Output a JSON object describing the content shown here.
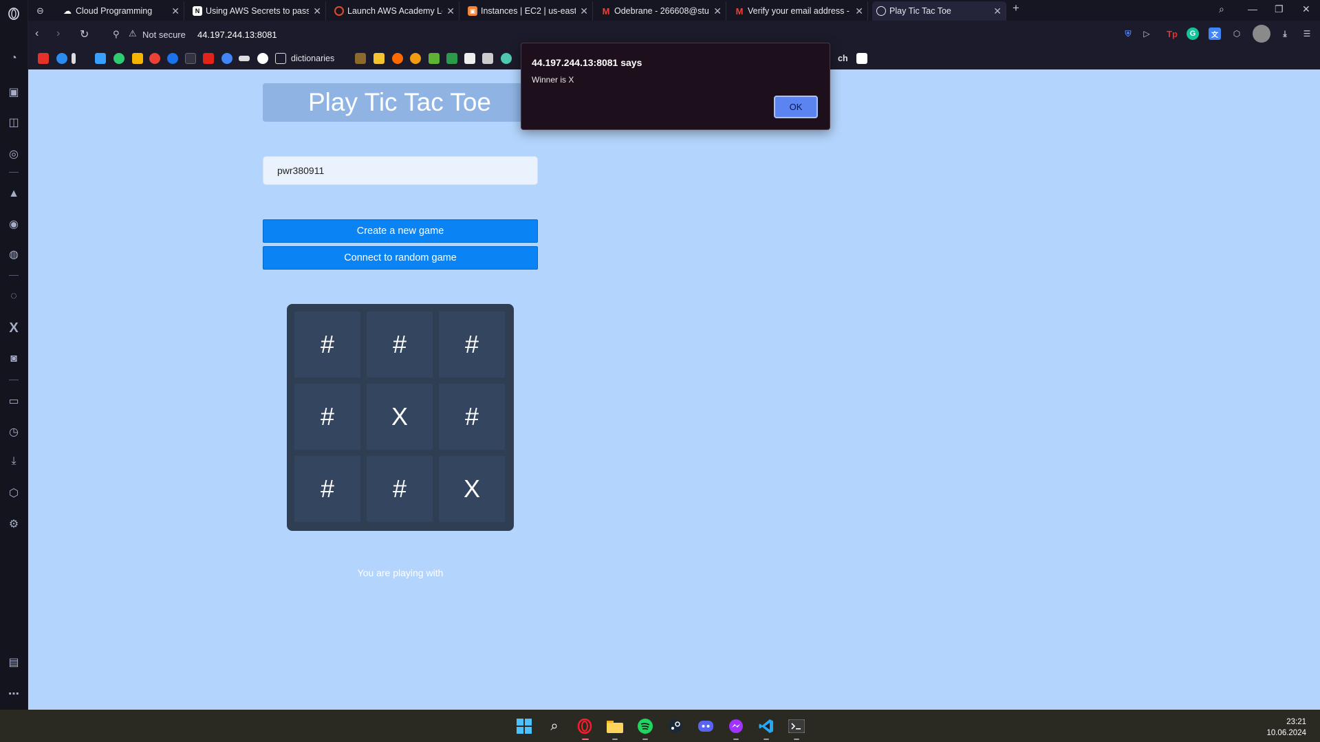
{
  "browser": {
    "tabs": [
      {
        "label": "Cloud Programming",
        "favicon": "cloud-icon",
        "active": false
      },
      {
        "label": "Using AWS Secrets to pass",
        "favicon": "notion-icon",
        "active": false
      },
      {
        "label": "Launch AWS Academy Lear",
        "favicon": "aws-academy-icon",
        "active": false
      },
      {
        "label": "Instances | EC2 | us-east-1",
        "favicon": "ec2-icon",
        "active": false
      },
      {
        "label": "Odebrane - 266608@stude",
        "favicon": "gmail-icon",
        "active": false
      },
      {
        "label": "Verify your email address -",
        "favicon": "gmail-icon",
        "active": false
      },
      {
        "label": "Play Tic Tac Toe",
        "favicon": "globe-icon",
        "active": true
      }
    ],
    "address": {
      "security_label": "Not secure",
      "url": "44.197.244.13:8081"
    },
    "bookmarks": {
      "folder_label": "dictionaries",
      "text_item": "ch"
    }
  },
  "page": {
    "title": "Play Tic Tac Toe",
    "login_value": "pwr380911",
    "create_game_label": "Create a new game",
    "connect_random_label": "Connect to random game",
    "board": [
      "#",
      "#",
      "#",
      "#",
      "X",
      "#",
      "#",
      "#",
      "X"
    ],
    "opponent_text": "You are playing with"
  },
  "alert": {
    "title": "44.197.244.13:8081 says",
    "message": "Winner is X",
    "ok_label": "OK"
  },
  "taskbar": {
    "time": "23:21",
    "date": "10.06.2024"
  },
  "colors": {
    "page_background": "#b3d4fc",
    "board_background": "#2f3e52",
    "cell_background": "#34465f",
    "button_blue": "#0a84f5",
    "alert_background": "#1d0f1b"
  }
}
